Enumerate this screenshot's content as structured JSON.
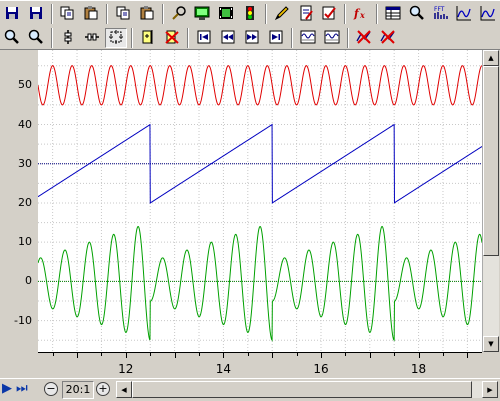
{
  "toolbar_row1": [
    {
      "name": "save-icon",
      "kind": "disk",
      "color": "#000080"
    },
    {
      "name": "save-all-icon",
      "kind": "disk",
      "color": "#000080"
    },
    {
      "sep": true
    },
    {
      "name": "copy-icon",
      "kind": "copy"
    },
    {
      "name": "paste-icon",
      "kind": "paste"
    },
    {
      "sep": true
    },
    {
      "name": "copy-data-icon",
      "kind": "copy"
    },
    {
      "name": "copy-clipboard-icon",
      "kind": "paste"
    },
    {
      "sep": true
    },
    {
      "name": "probe-icon",
      "kind": "probe"
    },
    {
      "name": "monitor-icon",
      "kind": "monitor"
    },
    {
      "name": "film-icon",
      "kind": "film"
    },
    {
      "name": "signal-icon",
      "kind": "signal"
    },
    {
      "sep": true
    },
    {
      "name": "pencil-icon",
      "kind": "pencil"
    },
    {
      "name": "edit-doc-icon",
      "kind": "doc"
    },
    {
      "name": "check-icon",
      "kind": "check"
    },
    {
      "sep": true
    },
    {
      "name": "function-icon",
      "kind": "fx",
      "label": "fx"
    },
    {
      "sep": true
    },
    {
      "name": "table-icon",
      "kind": "table"
    },
    {
      "name": "zoom-graph-icon",
      "kind": "mag"
    },
    {
      "name": "fft-icon",
      "kind": "fft",
      "label": "FFT"
    },
    {
      "name": "plot-icon",
      "kind": "plot"
    },
    {
      "name": "plot-xy-icon",
      "kind": "plot"
    }
  ],
  "toolbar_row2": [
    {
      "name": "zoom-out-icon",
      "kind": "mag"
    },
    {
      "name": "zoom-in-icon",
      "kind": "mag"
    },
    {
      "sep": true
    },
    {
      "name": "cursor-a-icon",
      "kind": "cursor"
    },
    {
      "name": "cursor-b-icon",
      "kind": "cursor2"
    },
    {
      "name": "fit-icon",
      "kind": "fit",
      "pressed": true
    },
    {
      "sep": true
    },
    {
      "name": "add-marker-icon",
      "kind": "marker"
    },
    {
      "name": "remove-marker-icon",
      "kind": "xmark"
    },
    {
      "sep": true
    },
    {
      "name": "first-icon",
      "kind": "first"
    },
    {
      "name": "rewind-icon",
      "kind": "rewind"
    },
    {
      "name": "forward-icon",
      "kind": "forward"
    },
    {
      "name": "last-icon",
      "kind": "last"
    },
    {
      "sep": true
    },
    {
      "name": "wave-view-icon",
      "kind": "wave"
    },
    {
      "name": "wave-list-icon",
      "kind": "wave"
    },
    {
      "sep": true
    },
    {
      "name": "delete-trace-icon",
      "kind": "xtrace"
    },
    {
      "name": "delete-all-icon",
      "kind": "xtrace"
    }
  ],
  "chart_data": {
    "type": "line",
    "xlim": [
      10.2,
      19.3
    ],
    "ylim": [
      -18,
      59
    ],
    "xticks": [
      12,
      14,
      16,
      18
    ],
    "yticks": [
      50,
      40,
      30,
      20,
      10,
      0,
      -10
    ],
    "grid": true,
    "reference_lines": [
      {
        "y": 30,
        "color": "#000080"
      },
      {
        "y": 0,
        "color": "#008000"
      }
    ],
    "series": [
      {
        "kind": "sine",
        "color": "#e00000",
        "offset": 50,
        "amplitude": 5,
        "period": 0.4
      },
      {
        "kind": "sawtooth",
        "color": "#0000c0",
        "base": 20,
        "top": 40,
        "period": 2.5,
        "phase": 12.5
      },
      {
        "kind": "composite",
        "color": "#00a000",
        "offset": 0,
        "envelope_start": 5,
        "envelope_end": 15,
        "period": 0.5,
        "reset_period": 2.5,
        "phase": 12.5
      }
    ]
  },
  "zoom": {
    "label": "20:1",
    "minus": "−",
    "plus": "+"
  },
  "nav": {
    "play": "▶",
    "end": "⏭"
  },
  "scroll": {
    "up": "▲",
    "down": "▼",
    "left": "◀",
    "right": "▶"
  }
}
